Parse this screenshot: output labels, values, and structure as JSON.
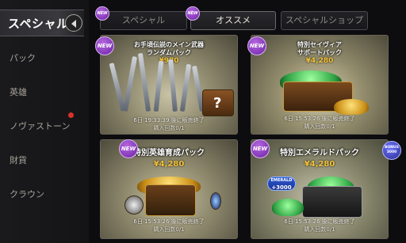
{
  "sidebar": {
    "active_label": "スペシャル",
    "items": [
      {
        "label": "パック"
      },
      {
        "label": "英雄"
      },
      {
        "label": "ノヴァストーン"
      },
      {
        "label": "財貨"
      },
      {
        "label": "クラウン"
      }
    ]
  },
  "tabs": [
    {
      "label": "スペシャル",
      "badge": "NEW"
    },
    {
      "label": "オススメ",
      "badge": "NEW"
    },
    {
      "label": "スペシャルショップ"
    }
  ],
  "cards": [
    {
      "badge": "NEW",
      "title_line1": "お手頃伝説のメイン武器",
      "title_line2": "ランダムパック",
      "price": "¥980",
      "sale_end": "6日 19:33:39 後に販売終了",
      "limit": "購入回数0/1"
    },
    {
      "badge": "NEW",
      "title_line1": "特別セイヴィア",
      "title_line2": "サポートパック",
      "price": "¥4,280",
      "sale_end": "6日 15:53:26 後に販売終了",
      "limit": "購入回数0/1"
    },
    {
      "badge": "NEW",
      "title_line1": "特別英雄育成パック",
      "price": "¥4,280",
      "sale_end": "6日 15:53:26 後に販売終了",
      "limit": "購入回数0/1"
    },
    {
      "badge": "NEW",
      "title_line1": "特別エメラルドパック",
      "price": "¥4,280",
      "sale_end": "6日 15:53:26 後に販売終了",
      "limit": "購入回数0/1",
      "emerald_tag_label": "EMERALD",
      "emerald_tag_value": "+3000",
      "bonus_label": "BONUS",
      "bonus_value": "3000"
    }
  ]
}
